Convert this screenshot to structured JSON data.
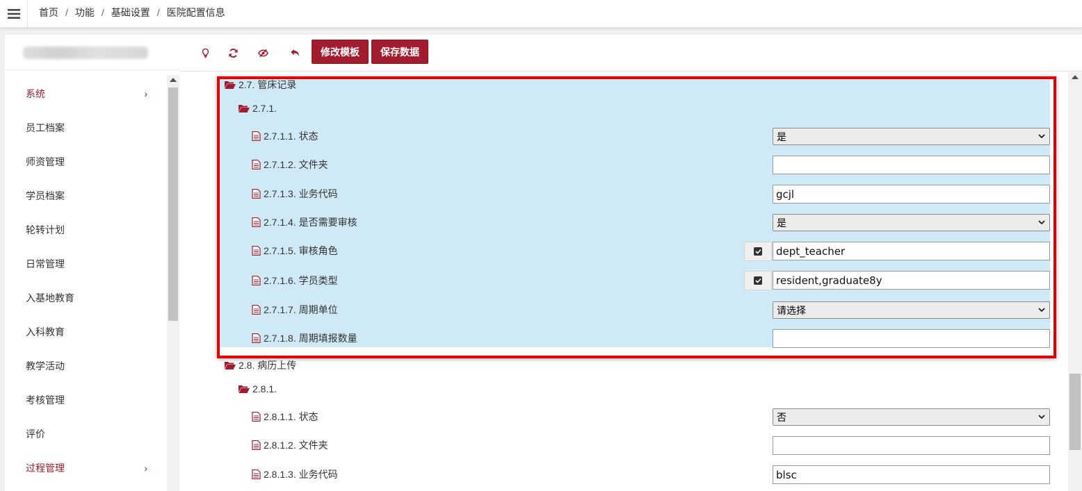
{
  "breadcrumb": [
    "首页",
    "功能",
    "基础设置",
    "医院配置信息"
  ],
  "brand_color": "#a31c2e",
  "highlight_color": "#cfe9f6",
  "sidebar": {
    "items": [
      {
        "label": "系统",
        "active": true,
        "chevron": "›"
      },
      {
        "label": "员工档案"
      },
      {
        "label": "师资管理"
      },
      {
        "label": "学员档案"
      },
      {
        "label": "轮转计划"
      },
      {
        "label": "日常管理"
      },
      {
        "label": "入基地教育"
      },
      {
        "label": "入科教育"
      },
      {
        "label": "教学活动"
      },
      {
        "label": "考核管理"
      },
      {
        "label": "评价"
      },
      {
        "label": "过程管理",
        "active": true,
        "chevron": "›"
      }
    ]
  },
  "toolbar": {
    "icons": [
      "lightbulb-icon",
      "refresh-icon",
      "eye-slash-icon",
      "undo-icon"
    ],
    "edit_template_label": "修改模板",
    "save_data_label": "保存数据"
  },
  "tree": {
    "n27": {
      "label": "2.7. 管床记录"
    },
    "n271": {
      "label": "2.7.1."
    },
    "n2711": {
      "label": "2.7.1.1. 状态",
      "value": "是"
    },
    "n2712": {
      "label": "2.7.1.2. 文件夹",
      "value": ""
    },
    "n2713": {
      "label": "2.7.1.3. 业务代码",
      "value": "gcjl"
    },
    "n2714": {
      "label": "2.7.1.4. 是否需要审核",
      "value": "是"
    },
    "n2715": {
      "label": "2.7.1.5. 审核角色",
      "value": "dept_teacher",
      "checked": true
    },
    "n2716": {
      "label": "2.7.1.6. 学员类型",
      "value": "resident,graduate8y",
      "checked": true
    },
    "n2717": {
      "label": "2.7.1.7. 周期单位",
      "value": "请选择"
    },
    "n2718": {
      "label": "2.7.1.8. 周期填报数量",
      "value": ""
    },
    "n28": {
      "label": "2.8. 病历上传"
    },
    "n281": {
      "label": "2.8.1."
    },
    "n2811": {
      "label": "2.8.1.1. 状态",
      "value": "否"
    },
    "n2812": {
      "label": "2.8.1.2. 文件夹",
      "value": ""
    },
    "n2813": {
      "label": "2.8.1.3. 业务代码",
      "value": "blsc"
    }
  }
}
